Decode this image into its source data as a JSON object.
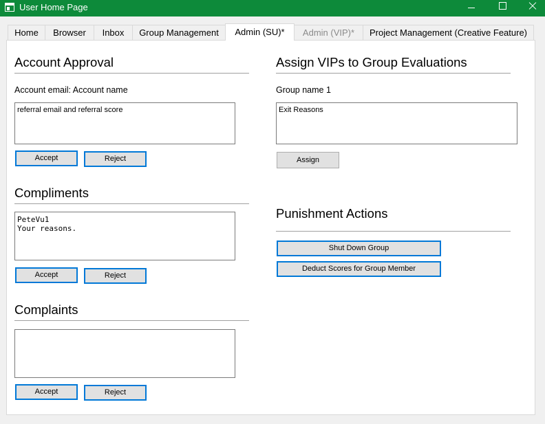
{
  "window": {
    "title": "User Home Page",
    "colors": {
      "titlebar": "#0d8a3a",
      "focus_border": "#0078d7"
    }
  },
  "tabs": [
    {
      "label": "Home"
    },
    {
      "label": "Browser"
    },
    {
      "label": "Inbox"
    },
    {
      "label": "Group Management"
    },
    {
      "label": "Admin (SU)*",
      "active": true
    },
    {
      "label": "Admin (VIP)*",
      "disabled": true
    },
    {
      "label": "Project Management (Creative Feature)"
    }
  ],
  "account_approval": {
    "heading": "Account Approval",
    "account_label": "Account email: Account name",
    "text": "referral email and referral score",
    "accept_label": "Accept",
    "reject_label": "Reject"
  },
  "compliments": {
    "heading": "Compliments",
    "text": "PeteVu1\nYour reasons.",
    "accept_label": "Accept",
    "reject_label": "Reject"
  },
  "complaints": {
    "heading": "Complaints",
    "text": "",
    "accept_label": "Accept",
    "reject_label": "Reject"
  },
  "assign_vips": {
    "heading": "Assign VIPs to Group Evaluations",
    "group_label": "Group name 1",
    "text": "Exit Reasons",
    "assign_label": "Assign"
  },
  "punishment": {
    "heading": "Punishment Actions",
    "shutdown_label": "Shut Down Group",
    "deduct_label": "Deduct Scores for Group Member"
  }
}
